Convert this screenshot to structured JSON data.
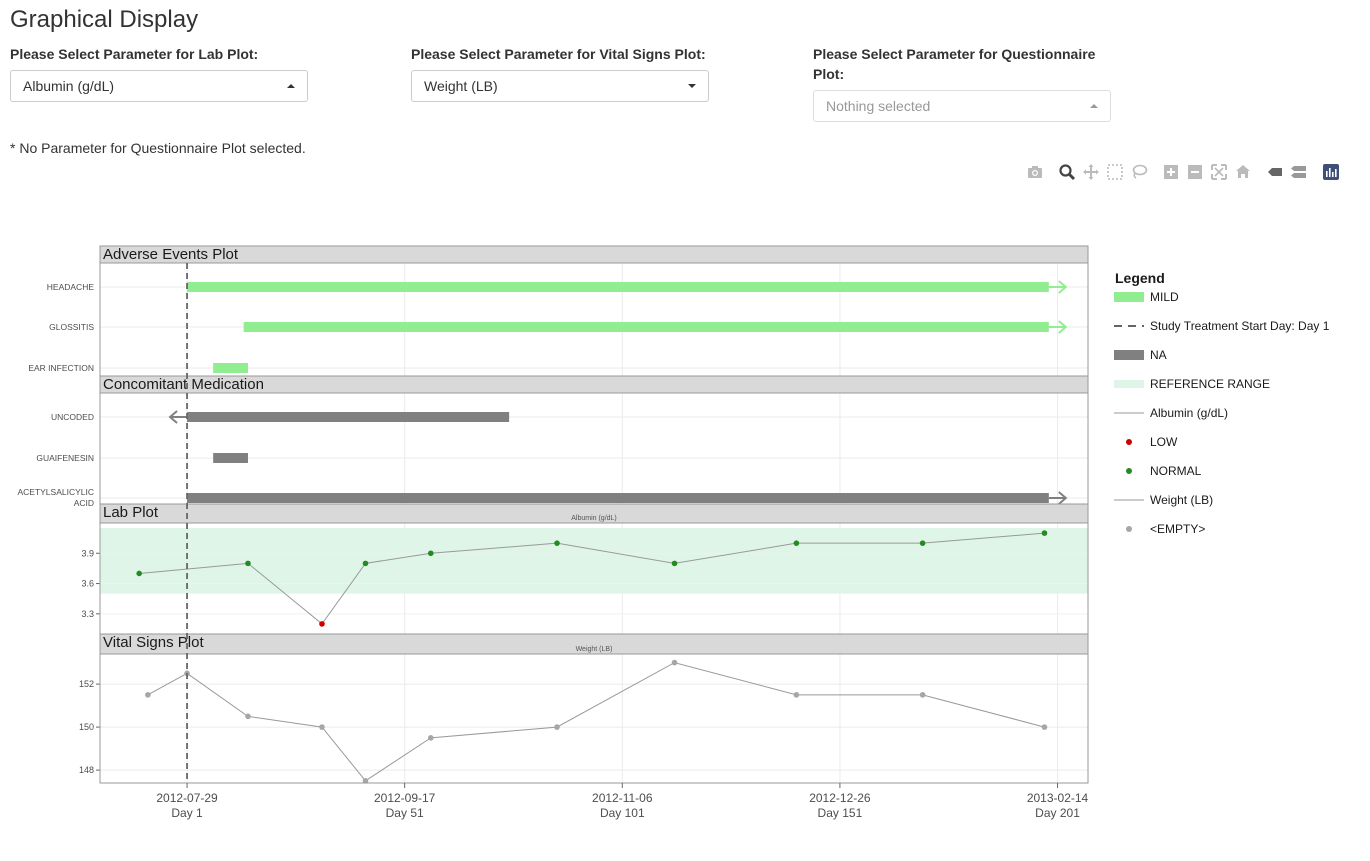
{
  "page": {
    "title": "Graphical Display"
  },
  "selectors": {
    "lab": {
      "label": "Please Select Parameter for Lab Plot:",
      "value": "Albumin (g/dL)"
    },
    "vital": {
      "label": "Please Select Parameter for Vital Signs Plot:",
      "value": "Weight (LB)"
    },
    "questionnaire": {
      "label_line1": "Please Select Parameter for Questionnaire",
      "label_line2": "Plot:",
      "placeholder": "Nothing selected"
    }
  },
  "note": "* No Parameter for Questionnaire Plot selected.",
  "toolbar": {
    "icons": [
      "camera-icon",
      "zoom-icon",
      "pan-icon",
      "box-select-icon",
      "lasso-select-icon",
      "zoom-in-icon",
      "zoom-out-icon",
      "autoscale-icon",
      "reset-axes-icon",
      "show-closest-icon",
      "compare-data-icon",
      "plotly-logo-icon"
    ]
  },
  "colors": {
    "mild": "#90EE90",
    "na": "#808080",
    "reference": "#dff5e8",
    "low": "#cc0000",
    "normal": "#228b22",
    "empty": "#a6a6a6",
    "panel_header": "#d9d9d9"
  },
  "chart_data": [
    {
      "type": "bar",
      "panel_title": "Adverse Events Plot",
      "x_axis": "date",
      "events": [
        {
          "term": "HEADACHE",
          "start": "2012-07-29",
          "end": "2013-02-12",
          "severity": "MILD",
          "ongoing": true
        },
        {
          "term": "GLOSSITIS",
          "start": "2012-08-11",
          "end": "2013-02-12",
          "severity": "MILD",
          "ongoing": true
        },
        {
          "term": "EAR INFECTION",
          "start": "2012-08-04",
          "end": "2012-08-12",
          "severity": "MILD",
          "ongoing": false
        }
      ]
    },
    {
      "type": "bar",
      "panel_title": "Concomitant Medication",
      "x_axis": "date",
      "medications": [
        {
          "term": "UNCODED",
          "start": "2012-07-29",
          "end": "2012-10-11",
          "category": "NA",
          "started_before": true,
          "ongoing": false
        },
        {
          "term": "GUAIFENESIN",
          "start": "2012-08-04",
          "end": "2012-08-12",
          "category": "NA",
          "started_before": false,
          "ongoing": false
        },
        {
          "term": "ACETYLSALICYLIC ACID",
          "term_line1": "ACETYLSALICYLIC",
          "term_line2": "ACID",
          "start": "2012-07-29",
          "end": "2013-02-12",
          "category": "NA",
          "started_before": false,
          "ongoing": true
        }
      ]
    },
    {
      "type": "line",
      "panel_title": "Lab Plot",
      "subtitle": "Albumin (g/dL)",
      "reference_range": [
        3.5,
        4.15
      ],
      "ylim": [
        3.1,
        4.2
      ],
      "yticks": [
        3.3,
        3.6,
        3.9
      ],
      "ytick_labels": [
        "3.3",
        "3.6",
        "3.9"
      ],
      "points": [
        {
          "x": "2012-07-18",
          "y": 3.7,
          "flag": "NORMAL"
        },
        {
          "x": "2012-08-12",
          "y": 3.8,
          "flag": "NORMAL"
        },
        {
          "x": "2012-08-29",
          "y": 3.2,
          "flag": "LOW"
        },
        {
          "x": "2012-09-08",
          "y": 3.8,
          "flag": "NORMAL"
        },
        {
          "x": "2012-09-23",
          "y": 3.9,
          "flag": "NORMAL"
        },
        {
          "x": "2012-10-22",
          "y": 4.0,
          "flag": "NORMAL"
        },
        {
          "x": "2012-11-18",
          "y": 3.8,
          "flag": "NORMAL"
        },
        {
          "x": "2012-12-16",
          "y": 4.0,
          "flag": "NORMAL"
        },
        {
          "x": "2013-01-14",
          "y": 4.0,
          "flag": "NORMAL"
        },
        {
          "x": "2013-02-11",
          "y": 4.1,
          "flag": "NORMAL"
        }
      ]
    },
    {
      "type": "line",
      "panel_title": "Vital Signs Plot",
      "subtitle": "Weight (LB)",
      "ylim": [
        147.4,
        153.4
      ],
      "yticks": [
        148,
        150,
        152
      ],
      "ytick_labels": [
        "148",
        "150",
        "152"
      ],
      "points": [
        {
          "x": "2012-07-20",
          "y": 151.5,
          "flag": "<EMPTY>"
        },
        {
          "x": "2012-07-29",
          "y": 152.5,
          "flag": "<EMPTY>"
        },
        {
          "x": "2012-08-12",
          "y": 150.5,
          "flag": "<EMPTY>"
        },
        {
          "x": "2012-08-29",
          "y": 150.0,
          "flag": "<EMPTY>"
        },
        {
          "x": "2012-09-08",
          "y": 147.5,
          "flag": "<EMPTY>"
        },
        {
          "x": "2012-09-23",
          "y": 149.5,
          "flag": "<EMPTY>"
        },
        {
          "x": "2012-10-22",
          "y": 150.0,
          "flag": "<EMPTY>"
        },
        {
          "x": "2012-11-18",
          "y": 153.0,
          "flag": "<EMPTY>"
        },
        {
          "x": "2012-12-16",
          "y": 151.5,
          "flag": "<EMPTY>"
        },
        {
          "x": "2013-01-14",
          "y": 151.5,
          "flag": "<EMPTY>"
        },
        {
          "x": "2013-02-11",
          "y": 150.0,
          "flag": "<EMPTY>"
        }
      ]
    }
  ],
  "x_axis": {
    "range": [
      "2012-07-09",
      "2013-02-21"
    ],
    "ticks": [
      {
        "date": "2012-07-29",
        "label": "2012-07-29",
        "day": "Day 1"
      },
      {
        "date": "2012-09-17",
        "label": "2012-09-17",
        "day": "Day 51"
      },
      {
        "date": "2012-11-06",
        "label": "2012-11-06",
        "day": "Day 101"
      },
      {
        "date": "2012-12-26",
        "label": "2012-12-26",
        "day": "Day 151"
      },
      {
        "date": "2013-02-14",
        "label": "2013-02-14",
        "day": "Day 201"
      }
    ],
    "treatment_start": "2012-07-29"
  },
  "legend": {
    "title": "Legend",
    "items": [
      {
        "label": "MILD",
        "kind": "bar",
        "color": "#90EE90"
      },
      {
        "label": "Study Treatment Start Day: Day 1",
        "kind": "dash",
        "color": "#666666"
      },
      {
        "label": "NA",
        "kind": "bar",
        "color": "#808080"
      },
      {
        "label": "REFERENCE RANGE",
        "kind": "fill",
        "color": "#dff5e8"
      },
      {
        "label": "Albumin (g/dL)",
        "kind": "line",
        "color": "#999999"
      },
      {
        "label": "LOW",
        "kind": "dot",
        "color": "#cc0000"
      },
      {
        "label": "NORMAL",
        "kind": "dot",
        "color": "#228b22"
      },
      {
        "label": "Weight (LB)",
        "kind": "line",
        "color": "#999999"
      },
      {
        "label": "<EMPTY>",
        "kind": "dot",
        "color": "#a6a6a6"
      }
    ]
  }
}
